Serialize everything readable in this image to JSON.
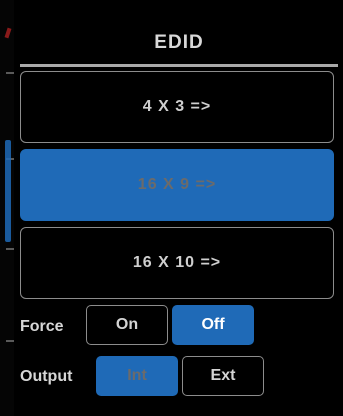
{
  "panel": {
    "title": "EDID"
  },
  "ratios": [
    {
      "label": "4 X 3 =>",
      "selected": false
    },
    {
      "label": "16 X 9 =>",
      "selected": true
    },
    {
      "label": "16 X 10 =>",
      "selected": false
    }
  ],
  "force": {
    "label": "Force",
    "on_label": "On",
    "off_label": "Off",
    "selected": "Off"
  },
  "output": {
    "label": "Output",
    "int_label": "Int",
    "ext_label": "Ext",
    "selected": "Int"
  },
  "colors": {
    "accent_blue": "#1f6ab7",
    "background": "#000000",
    "border_gray": "#8c8c8c",
    "text_light": "#d9d9d9"
  }
}
